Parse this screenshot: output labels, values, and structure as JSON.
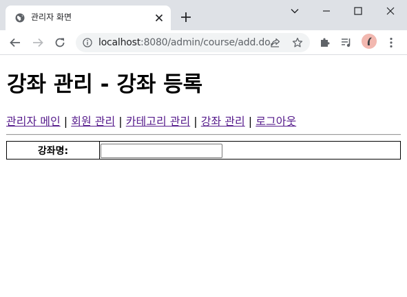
{
  "browser": {
    "tab_title": "관리자 화면",
    "url_host": "localhost",
    "url_path": ":8080/admin/course/add.do"
  },
  "page": {
    "heading": "강좌 관리 - 강좌 등록",
    "nav": [
      {
        "label": "관리자 메인"
      },
      {
        "label": "회원 관리"
      },
      {
        "label": "카테고리 관리"
      },
      {
        "label": "강좌 관리"
      },
      {
        "label": "로그아웃"
      }
    ],
    "nav_separator": " | ",
    "form": {
      "course_name_label": "강좌명:",
      "course_name_value": "",
      "course_name_placeholder": ""
    }
  },
  "colors": {
    "tabstrip": "#dee1e6",
    "visited_link": "#551a8b",
    "avatar": "#f2b8b0"
  }
}
